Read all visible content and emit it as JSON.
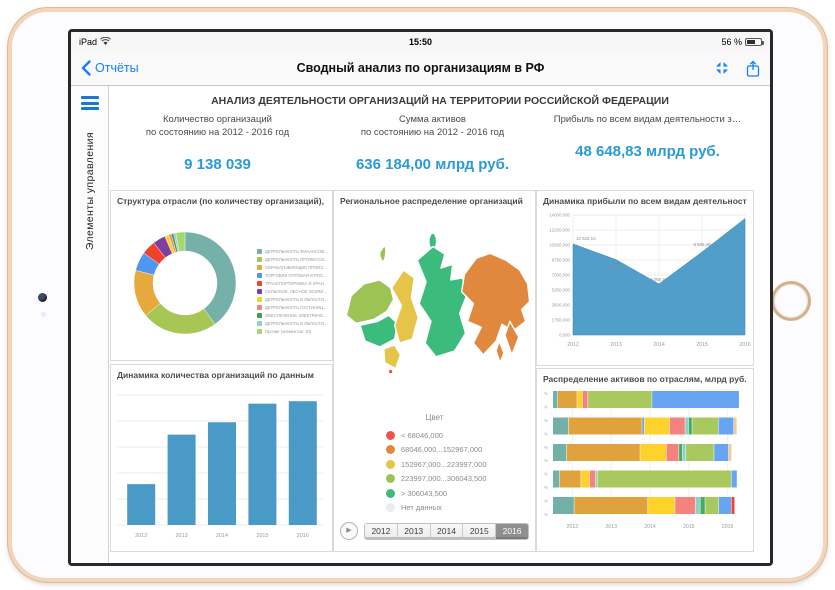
{
  "status": {
    "carrier": "iPad",
    "time": "15:50",
    "battery": "56 %"
  },
  "nav": {
    "back_label": "Отчёты",
    "title": "Сводный анализ по организациям в РФ"
  },
  "sidebar": {
    "vertical_label": "Элементы управления"
  },
  "report": {
    "title": "АНАЛИЗ ДЕЯТЕЛЬНОСТИ ОРГАНИЗАЦИЙ НА ТЕРРИТОРИИ РОССИЙСКОЙ ФЕДЕРАЦИИ"
  },
  "kpis": [
    {
      "line1": "Количество организаций",
      "line2": "по состоянию на 2012 - 2016 год",
      "value": "9 138 039"
    },
    {
      "line1": "Сумма активов",
      "line2": "по состоянию на 2012 - 2016 год",
      "value": "636 184,00 млрд руб."
    },
    {
      "line1": "Прибыль по всем видам деятельности з…",
      "line2": "",
      "value": "48 648,83 млрд руб."
    }
  ],
  "palette": {
    "teal": "#72b0a8",
    "orange": "#dfa23c",
    "yellow": "#ffd12b",
    "pink": "#f5827d",
    "green": "#3fae62",
    "ltteal": "#8ecfc6",
    "ygreen": "#a9c95e",
    "blue": "#67a4f2",
    "red": "#ef4331",
    "tan": "#f2cd8e",
    "chart_blue": "#4a9ac8",
    "accent": "#2b9ad6",
    "ios_blue": "#157efb"
  },
  "chart_data": [
    {
      "id": "industry-donut",
      "type": "pie",
      "title": "Структура отрасли (по количеству организаций), %",
      "values": [
        40,
        24,
        15,
        6,
        4.5,
        4,
        1.3,
        0.8,
        0.8,
        0.7,
        2.9
      ],
      "colors": [
        "#76b1a9",
        "#a8c654",
        "#e5a93d",
        "#4f95f2",
        "#f0432e",
        "#7e3f9f",
        "#f5d32a",
        "#f2837f",
        "#43a047",
        "#8fd0c8",
        "#a5d66f"
      ],
      "legend": [
        "ДЕЯТЕЛЬНОСТЬ ФИНАНСОВА...",
        "ДЕЯТЕЛЬНОСТЬ ПРОФЕССИ...",
        "ОБРАБАТЫВАЮЩИЕ ПРОИЗВ...",
        "ТОРГОВЛЯ ОПТОВАЯ И РОЗН...",
        "ТРАНСПОРТИРОВКА И ХРАНЕ...",
        "СЕЛЬСКОЕ, ЛЕСНОЕ ХОЗЯЙС...",
        "ДЕЯТЕЛЬНОСТЬ В ОБЛАСТИ...",
        "ДЕЯТЕЛЬНОСТЬ ГОСТИНИЦ...",
        "ОБЕСПЕЧЕНИЕ ЭЛЕКТРИЧЕС...",
        "ДЕЯТЕЛЬНОСТЬ В ОБЛАСТИ...",
        "Прочие (элементов: 10)"
      ],
      "legend_position": "right"
    },
    {
      "id": "org-count-bars",
      "type": "bar",
      "title": "Динамика количества организаций по данным",
      "categories": [
        "2012",
        "2013",
        "2014",
        "2015",
        "2016"
      ],
      "values": [
        33,
        73,
        83,
        98,
        100
      ],
      "ylim": [
        0,
        105
      ],
      "color": "#4a9ac8",
      "grid": true,
      "y_axis_labels": "hidden"
    },
    {
      "id": "profit-area",
      "type": "area",
      "title": "Динамика прибыли по всем видам деятельности,",
      "x": [
        "2012",
        "2013",
        "2014",
        "2015",
        "2016"
      ],
      "values": [
        10625.1,
        8795.47,
        5955.6,
        9685.48,
        13587.18
      ],
      "point_labels": [
        "10 625,10",
        "8 795,47",
        "5 955,60",
        "9 685,48",
        ""
      ],
      "y_ticks": [
        "14000,000",
        "12250,000",
        "10500,000",
        "8750,000",
        "7000,000",
        "5250,000",
        "3500,000",
        "1750,000",
        "0,000"
      ],
      "ylim": [
        0,
        14000
      ],
      "color": "#4a9ac8",
      "grid": true
    },
    {
      "id": "region-map",
      "type": "heatmap",
      "title": "Региональное распределение организаций",
      "legend_title": "Цвет",
      "legend": [
        {
          "color": "#ef5350",
          "label": "< 68046,000"
        },
        {
          "color": "#e0893e",
          "label": "68046,000...152967,000"
        },
        {
          "color": "#e6c448",
          "label": "152967,000...223997,000"
        },
        {
          "color": "#9cc353",
          "label": "223997,000...306043,500"
        },
        {
          "color": "#3bbc7d",
          "label": "> 306043,500"
        },
        {
          "color": "#ececec",
          "label": "Нет данных"
        }
      ],
      "regions": {
        "northwest": "#9cc353",
        "nw-sliver": "#9cc353",
        "central": "#3bbc7d",
        "south": "#e6c448",
        "south-spot": "#ef5350",
        "ural": "#e6c448",
        "siberia": "#3bbc7d",
        "islands": "#3bbc7d",
        "fareast": "#e0893e",
        "kamchatka": "#e0893e",
        "sakhalin": "#e0893e"
      },
      "years": [
        "2012",
        "2013",
        "2014",
        "2015",
        "2016"
      ],
      "selected_year": "2016",
      "play_glyph": "▶"
    },
    {
      "id": "assets-stacked",
      "type": "bar",
      "subtype": "stacked-horizontal",
      "title": "Распределение активов по отраслям, млрд руб.",
      "x_ticks": [
        "2012",
        "2013",
        "2014",
        "2015",
        "2016"
      ],
      "y_tick_label": "%",
      "rows": [
        [
          [
            "teal",
            2.5
          ],
          [
            "orange",
            10
          ],
          [
            "yellow",
            2.8
          ],
          [
            "pink",
            2.8
          ],
          [
            "ygreen",
            33
          ],
          [
            "blue",
            45
          ]
        ],
        [
          [
            "teal",
            8
          ],
          [
            "orange",
            38
          ],
          [
            "blue",
            1.2
          ],
          [
            "yellow",
            13
          ],
          [
            "pink",
            8
          ],
          [
            "ltteal",
            1.8
          ],
          [
            "green",
            1.8
          ],
          [
            "ygreen",
            13.5
          ],
          [
            "blue",
            8
          ],
          [
            "tan",
            1.6
          ]
        ],
        [
          [
            "teal",
            7
          ],
          [
            "orange",
            38
          ],
          [
            "yellow",
            13.5
          ],
          [
            "pink",
            6.5
          ],
          [
            "green",
            1.8
          ],
          [
            "ltteal",
            1.8
          ],
          [
            "ygreen",
            14.5
          ],
          [
            "blue",
            7.5
          ],
          [
            "tan",
            1.6
          ]
        ],
        [
          [
            "teal",
            3.5
          ],
          [
            "orange",
            11
          ],
          [
            "yellow",
            4.5
          ],
          [
            "pink",
            3
          ],
          [
            "ltteal",
            1
          ],
          [
            "ygreen",
            69
          ],
          [
            "blue",
            3
          ]
        ],
        [
          [
            "teal",
            11
          ],
          [
            "orange",
            38
          ],
          [
            "yellow",
            14
          ],
          [
            "pink",
            10.5
          ],
          [
            "ltteal",
            2.5
          ],
          [
            "green",
            2.5
          ],
          [
            "ygreen",
            7
          ],
          [
            "blue",
            6.5
          ],
          [
            "red",
            1.8
          ]
        ]
      ]
    }
  ]
}
